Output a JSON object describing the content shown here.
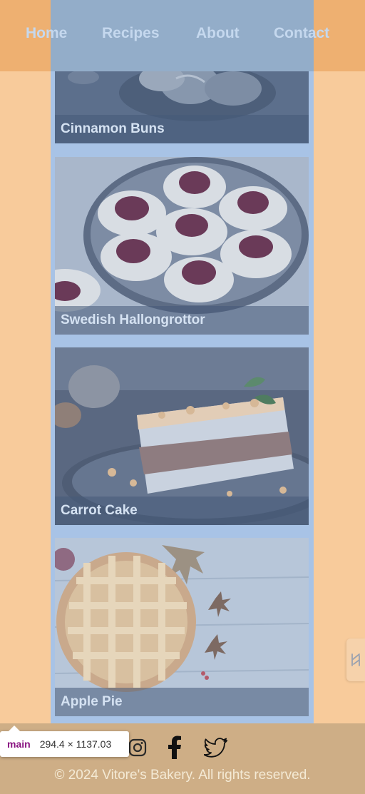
{
  "nav": {
    "items": [
      {
        "label": "Home"
      },
      {
        "label": "Recipes"
      },
      {
        "label": "About"
      },
      {
        "label": "Contact"
      }
    ]
  },
  "recipes": [
    {
      "title": "Cinnamon Buns"
    },
    {
      "title": "Swedish Hallongrottor"
    },
    {
      "title": "Carrot Cake"
    },
    {
      "title": "Apple Pie"
    }
  ],
  "footer": {
    "socials": [
      "instagram-icon",
      "facebook-icon",
      "twitter-icon"
    ],
    "copyright": "© 2024 Vitore's Bakery. All rights reserved."
  },
  "devtools": {
    "tag": "main",
    "dims": "294.4 × 1137.03"
  },
  "colors": {
    "page_bg": "#f8cb9b",
    "header_bg": "#eeb071",
    "main_overlay": "#a8c3e6",
    "footer_bg": "#ceae86"
  }
}
